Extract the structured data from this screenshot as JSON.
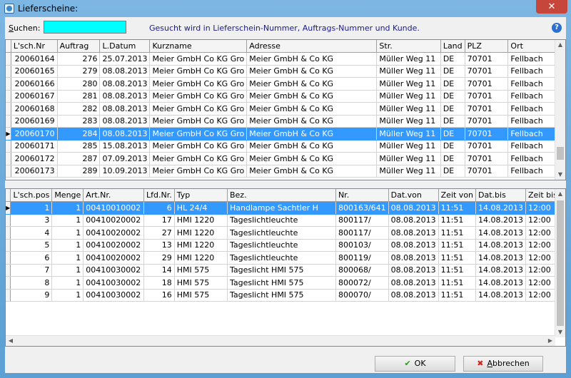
{
  "window": {
    "title": "Lieferscheine:",
    "close_glyph": "✕"
  },
  "search": {
    "label_ul": "S",
    "label_rest": "uchen:",
    "value": "",
    "hint": "Gesucht wird in Lieferschein-Nummer, Auftrags-Nummer und Kunde.",
    "help_glyph": "?"
  },
  "grid1": {
    "columns": [
      "L'sch.Nr",
      "Auftrag",
      "L.Datum",
      "Kurzname",
      "Adresse",
      "Str.",
      "Land",
      "PLZ",
      "Ort"
    ],
    "selected_index": 6,
    "rows": [
      [
        "20060164",
        "276",
        "25.07.2013",
        "Meier GmbH  Co KG Gro",
        "Meier GmbH & Co KG",
        "Müller Weg 11",
        "DE",
        "70701",
        "Fellbach"
      ],
      [
        "20060165",
        "279",
        "08.08.2013",
        "Meier GmbH  Co KG Gro",
        "Meier GmbH & Co KG",
        "Müller Weg 11",
        "DE",
        "70701",
        "Fellbach"
      ],
      [
        "20060166",
        "280",
        "08.08.2013",
        "Meier GmbH  Co KG Gro",
        "Meier GmbH & Co KG",
        "Müller Weg 11",
        "DE",
        "70701",
        "Fellbach"
      ],
      [
        "20060167",
        "281",
        "08.08.2013",
        "Meier GmbH  Co KG Gro",
        "Meier GmbH & Co KG",
        "Müller Weg 11",
        "DE",
        "70701",
        "Fellbach"
      ],
      [
        "20060168",
        "282",
        "08.08.2013",
        "Meier GmbH  Co KG Gro",
        "Meier GmbH & Co KG",
        "Müller Weg 11",
        "DE",
        "70701",
        "Fellbach"
      ],
      [
        "20060169",
        "283",
        "08.08.2013",
        "Meier GmbH  Co KG Gro",
        "Meier GmbH & Co KG",
        "Müller Weg 11",
        "DE",
        "70701",
        "Fellbach"
      ],
      [
        "20060170",
        "284",
        "08.08.2013",
        "Meier GmbH  Co KG Gro",
        "Meier GmbH & Co KG",
        "Müller Weg 11",
        "DE",
        "70701",
        "Fellbach"
      ],
      [
        "20060171",
        "285",
        "15.08.2013",
        "Meier GmbH  Co KG Gro",
        "Meier GmbH & Co KG",
        "Müller Weg 11",
        "DE",
        "70701",
        "Fellbach"
      ],
      [
        "20060172",
        "287",
        "07.09.2013",
        "Meier GmbH  Co KG Gro",
        "Meier GmbH & Co KG",
        "Müller Weg 11",
        "DE",
        "70701",
        "Fellbach"
      ],
      [
        "20060173",
        "289",
        "10.09.2013",
        "Meier GmbH  Co KG Gro",
        "Meier GmbH & Co KG",
        "Müller Weg 11",
        "DE",
        "70701",
        "Fellbach"
      ]
    ]
  },
  "grid2": {
    "columns": [
      "L'sch.pos",
      "Menge",
      "Art.Nr.",
      "Lfd.Nr.",
      "Typ",
      "Bez.",
      "Nr.",
      "Dat.von",
      "Zeit von",
      "Dat.bis",
      "Zeit bis"
    ],
    "selected_index": 0,
    "rows": [
      [
        "1",
        "1",
        "00410010002",
        "6",
        "HL 24/4",
        "Handlampe Sachtler H",
        "800163/641",
        "08.08.2013",
        "11:51",
        "14.08.2013",
        "12:00"
      ],
      [
        "3",
        "1",
        "00410020002",
        "17",
        "HMI 1220",
        "Tageslichtleuchte",
        "800117/",
        "08.08.2013",
        "11:51",
        "14.08.2013",
        "12:00"
      ],
      [
        "4",
        "1",
        "00410020002",
        "27",
        "HMI 1220",
        "Tageslichtleuchte",
        "800117/",
        "08.08.2013",
        "11:51",
        "14.08.2013",
        "12:00"
      ],
      [
        "5",
        "1",
        "00410020002",
        "13",
        "HMI 1220",
        "Tageslichtleuchte",
        "800103/",
        "08.08.2013",
        "11:51",
        "14.08.2013",
        "12:00"
      ],
      [
        "6",
        "1",
        "00410020002",
        "29",
        "HMI 1220",
        "Tageslichtleuchte",
        "800119/",
        "08.08.2013",
        "11:51",
        "14.08.2013",
        "12:00"
      ],
      [
        "7",
        "1",
        "00410030002",
        "14",
        "HMI 575",
        "Tageslicht HMI 575",
        "800068/",
        "08.08.2013",
        "11:51",
        "14.08.2013",
        "12:00"
      ],
      [
        "8",
        "1",
        "00410030002",
        "18",
        "HMI 575",
        "Tageslicht HMI 575",
        "800072/",
        "08.08.2013",
        "11:51",
        "14.08.2013",
        "12:00"
      ],
      [
        "9",
        "1",
        "00410030002",
        "16",
        "HMI 575",
        "Tageslicht HMI 575",
        "800070/",
        "08.08.2013",
        "11:51",
        "14.08.2013",
        "12:00"
      ]
    ]
  },
  "buttons": {
    "ok_label": "OK",
    "cancel_ul": "A",
    "cancel_rest": "bbrechen"
  },
  "icons": {
    "check": "check-icon",
    "cancel": "x-icon",
    "help": "help-icon"
  }
}
